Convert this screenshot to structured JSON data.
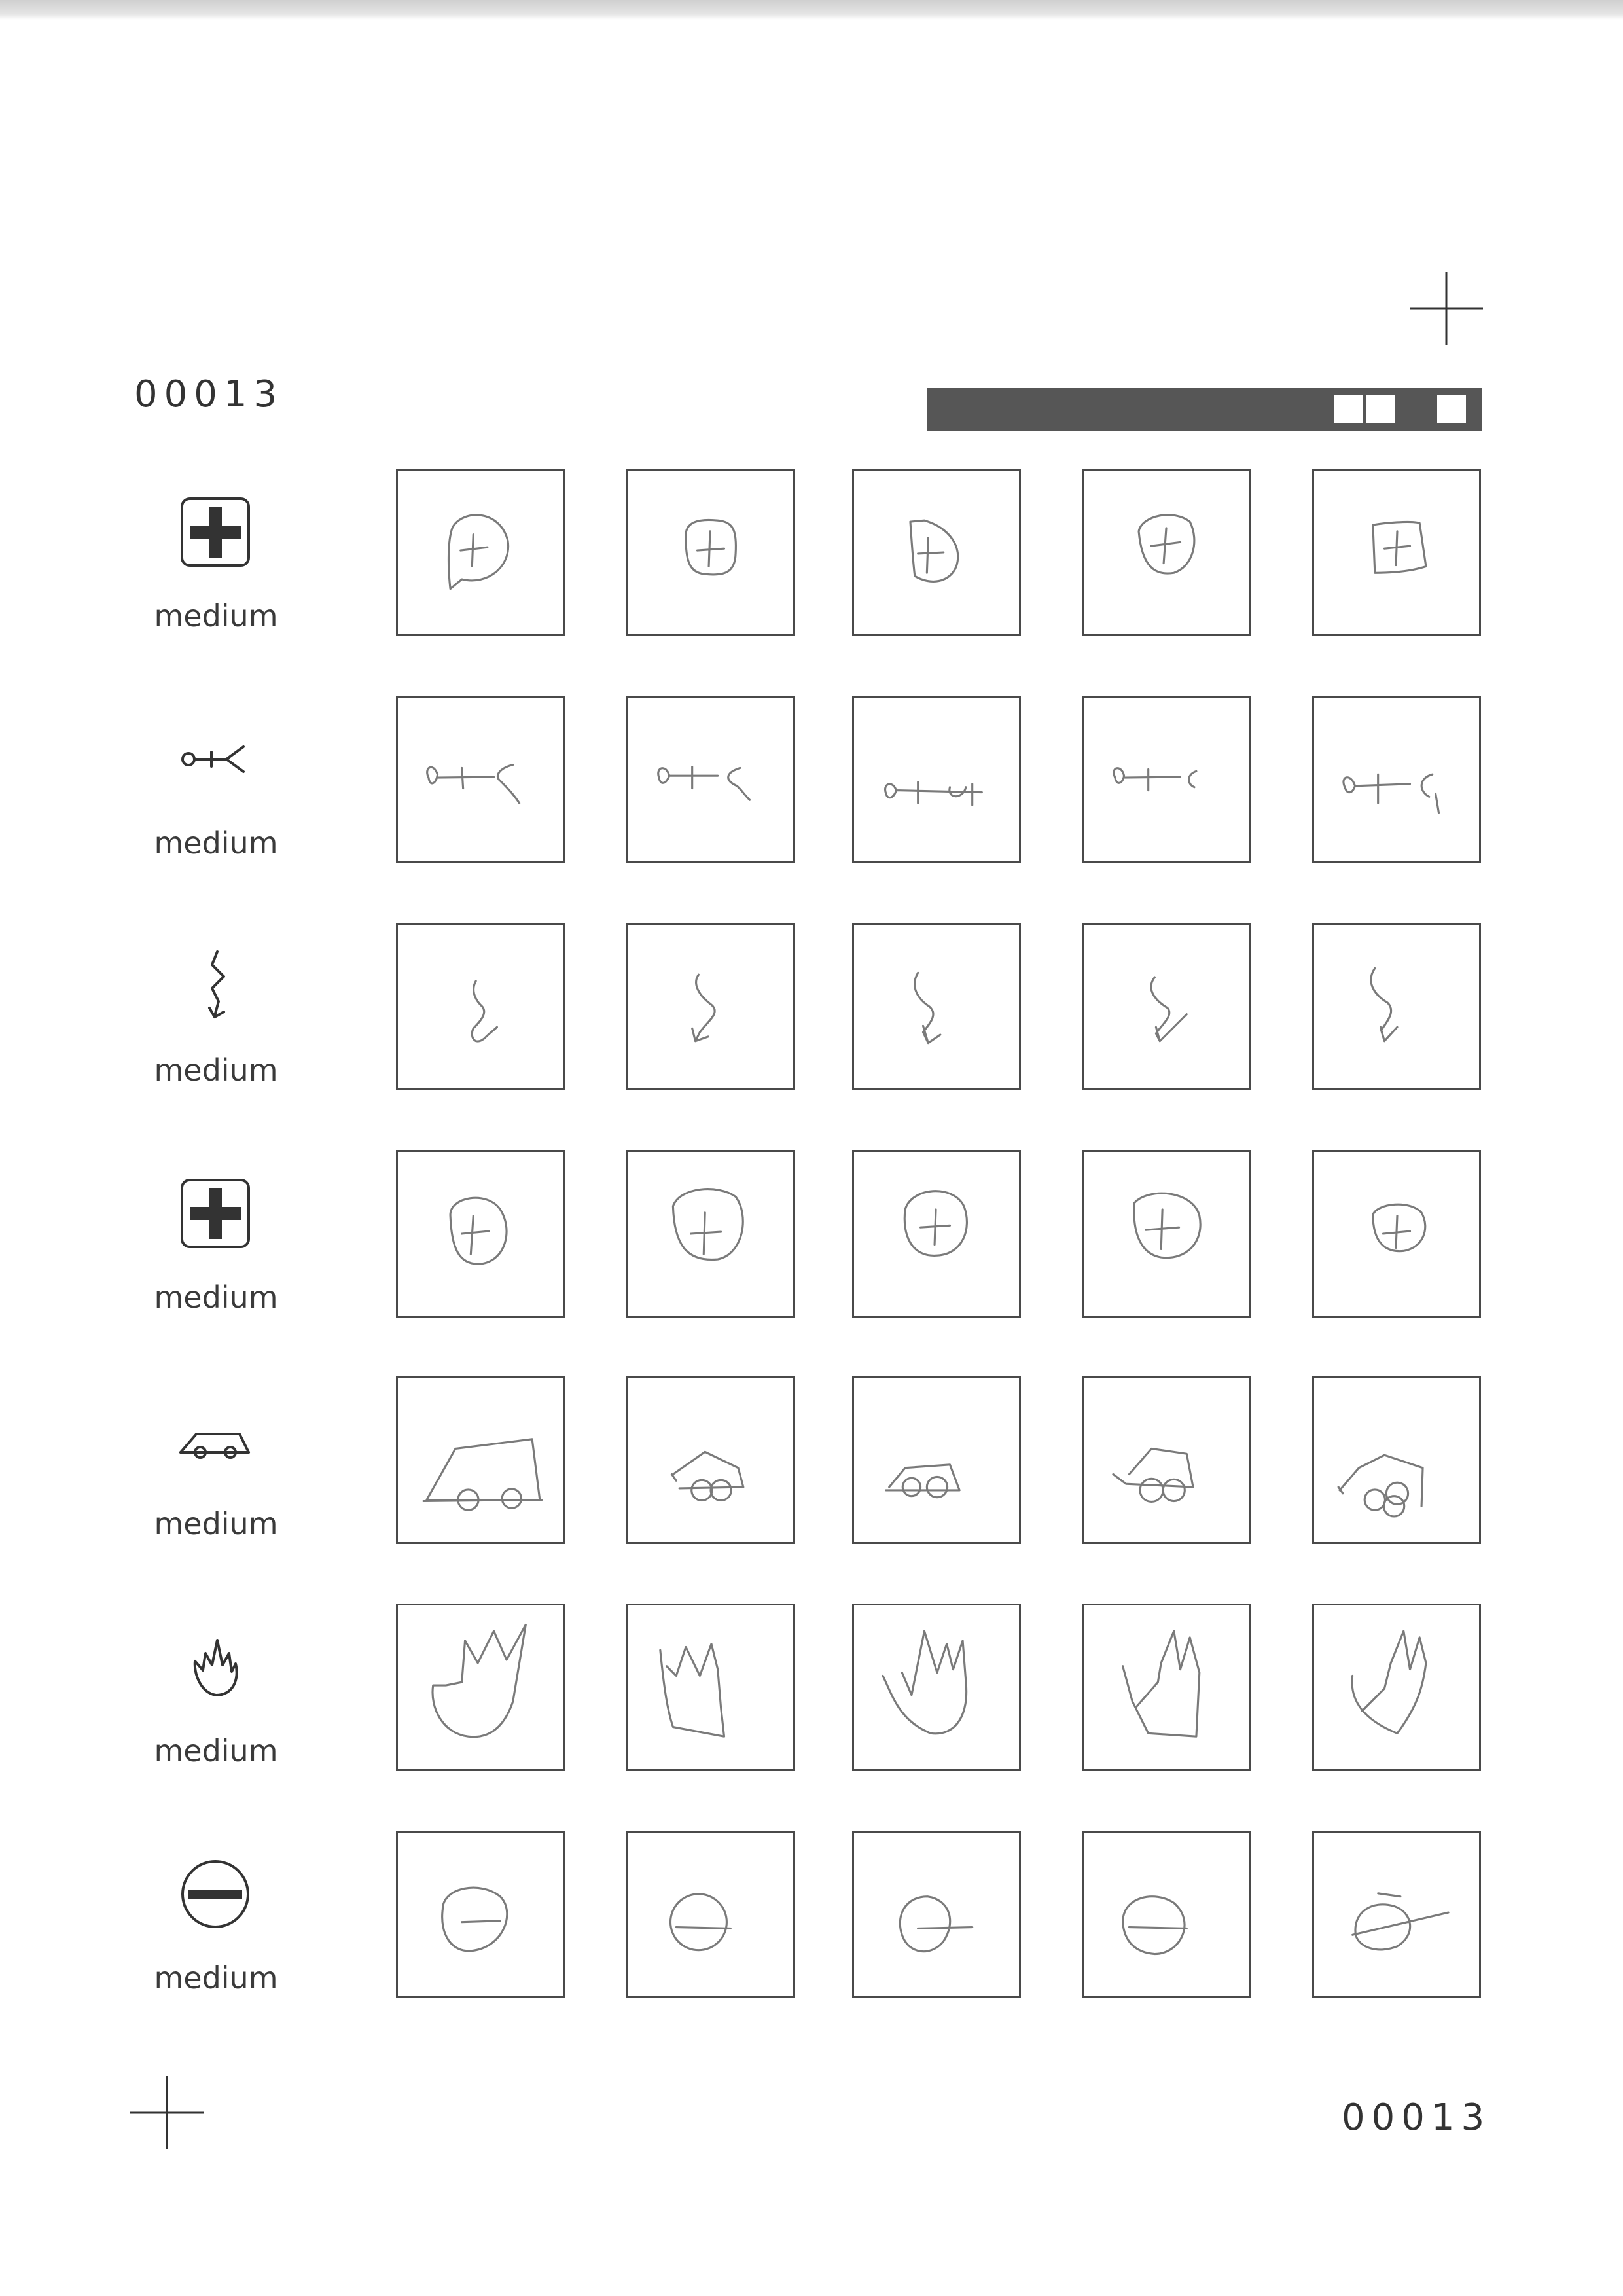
{
  "page": {
    "id_top": "00013",
    "id_bottom": "00013"
  },
  "rows": [
    {
      "icon": "first-aid-cross-icon",
      "difficulty": "medium"
    },
    {
      "icon": "stick-figure-icon",
      "difficulty": "medium"
    },
    {
      "icon": "lightning-arrow-icon",
      "difficulty": "medium"
    },
    {
      "icon": "first-aid-cross-icon",
      "difficulty": "medium"
    },
    {
      "icon": "car-icon",
      "difficulty": "medium"
    },
    {
      "icon": "flame-icon",
      "difficulty": "medium"
    },
    {
      "icon": "no-entry-icon",
      "difficulty": "medium"
    }
  ],
  "colors": {
    "ink": "#333333",
    "pencil": "#7a7a7a",
    "bar": "#565656"
  }
}
